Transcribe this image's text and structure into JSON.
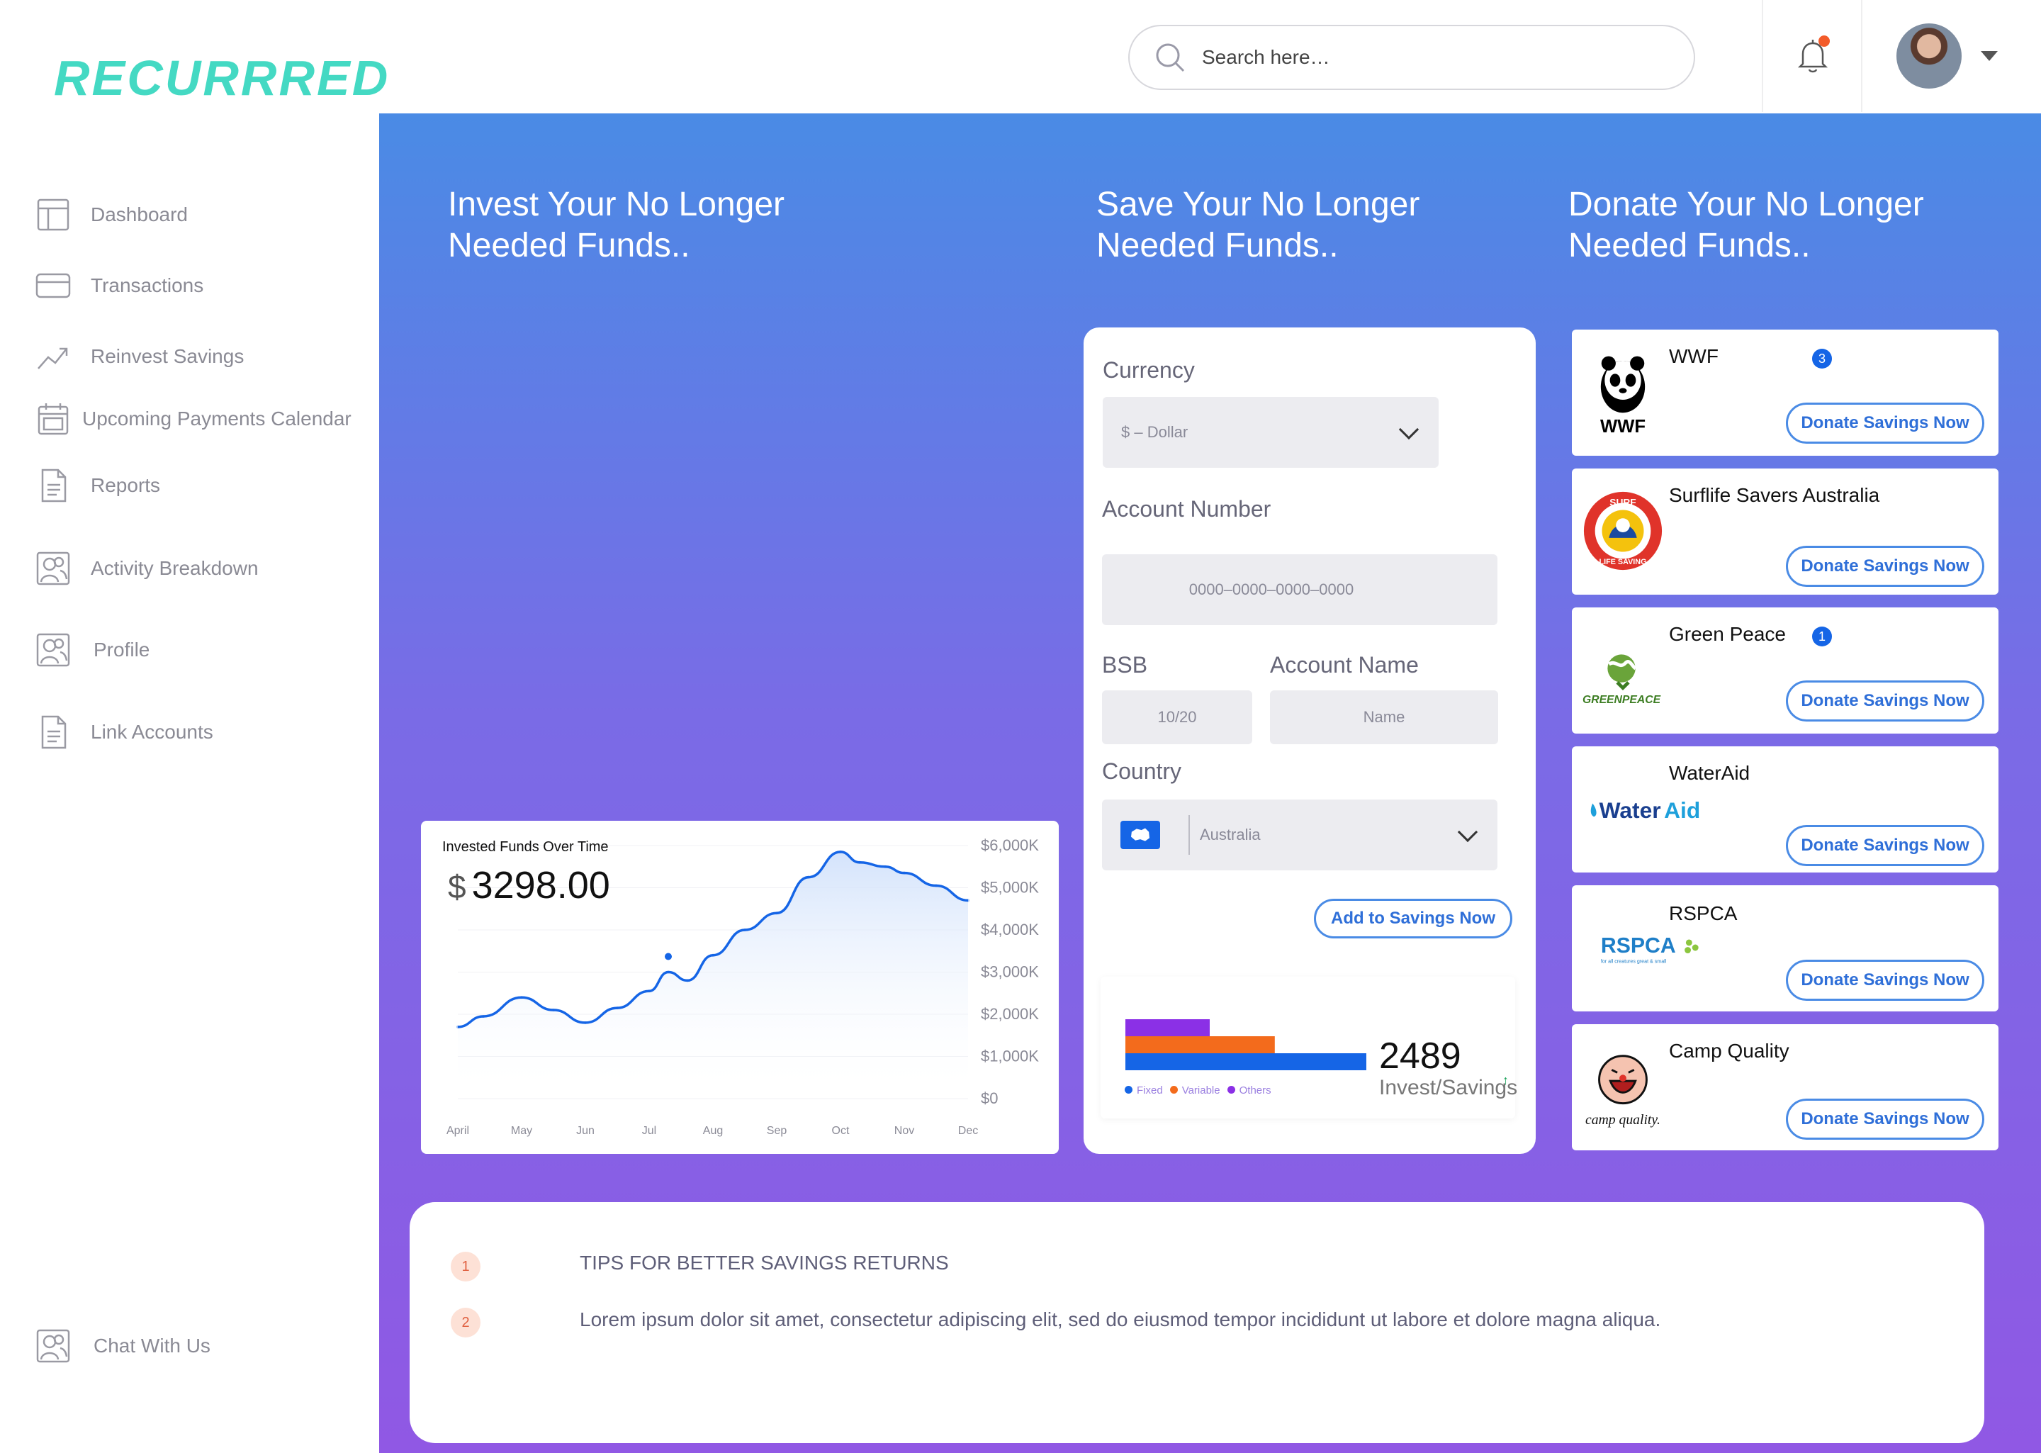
{
  "app": {
    "logo": "RECURRRED"
  },
  "sidebar": {
    "items": [
      {
        "label": "Dashboard",
        "icon": "dashboard-icon"
      },
      {
        "label": "Transactions",
        "icon": "card-icon"
      },
      {
        "label": "Reinvest Savings",
        "icon": "trend-icon"
      },
      {
        "label": "Upcoming Payments Calendar",
        "icon": "calendar-icon"
      },
      {
        "label": "Reports",
        "icon": "document-icon"
      },
      {
        "label": "Activity Breakdown",
        "icon": "users-icon"
      },
      {
        "label": "Profile",
        "icon": "user-icon"
      },
      {
        "label": "Link Accounts",
        "icon": "document-icon"
      }
    ],
    "chat": {
      "label": "Chat With Us",
      "icon": "user-icon"
    }
  },
  "header": {
    "search_placeholder": "Search here…",
    "notification_icon": "bell-icon"
  },
  "invest": {
    "title_line1": "Invest Your No Longer",
    "title_line2": "Needed Funds..",
    "chart_title": "Invested Funds Over Time",
    "currency_symbol": "$",
    "amount": "3298.00"
  },
  "save": {
    "title_line1": "Save Your No Longer",
    "title_line2": "Needed Funds..",
    "currency_label": "Currency",
    "currency_value": "$ – Dollar",
    "account_number_label": "Account Number",
    "account_number_placeholder": "0000–0000–0000–0000",
    "bsb_label": "BSB",
    "bsb_placeholder": "10/20",
    "account_name_label": "Account Name",
    "account_name_placeholder": "Name",
    "country_label": "Country",
    "country_value": "Australia",
    "add_button": "Add to Savings Now",
    "stat_value": "2489",
    "stat_label": "Invest/Savings",
    "legend": [
      "Fixed",
      "Variable",
      "Others"
    ]
  },
  "donate": {
    "title_line1": "Donate Your No Longer",
    "title_line2": "Needed Funds..",
    "button_label": "Donate Savings Now",
    "charities": [
      {
        "name": "WWF",
        "badge": "3",
        "logo_text": "WWF"
      },
      {
        "name": "Surflife Savers Australia",
        "badge": "",
        "logo_text": "SURF LIFE SAVING"
      },
      {
        "name": "Green Peace",
        "badge": "1",
        "logo_text": "GREENPEACE"
      },
      {
        "name": "WaterAid",
        "badge": "",
        "logo_text": "WaterAid"
      },
      {
        "name": "RSPCA",
        "badge": "",
        "logo_text": "RSPCA"
      },
      {
        "name": "Camp Quality",
        "badge": "",
        "logo_text": "camp quality."
      }
    ]
  },
  "tips": {
    "items": [
      {
        "num": "1",
        "text": "TIPS FOR BETTER SAVINGS RETURNS"
      },
      {
        "num": "2",
        "text": "Lorem ipsum dolor sit amet, consectetur adipiscing elit, sed do eiusmod tempor incididunt ut labore et dolore magna aliqua."
      }
    ]
  },
  "chart_data": [
    {
      "type": "line",
      "title": "Invested Funds Over Time",
      "categories": [
        "April",
        "May",
        "Jun",
        "Jul",
        "Aug",
        "Sep",
        "Oct",
        "Nov",
        "Dec"
      ],
      "y_ticks": [
        "$0",
        "$1,000K",
        "$2,000K",
        "$3,000K",
        "$4,000K",
        "$5,000K",
        "$6,000K"
      ],
      "ylim": [
        0,
        6000
      ],
      "series": [
        {
          "x": [
            0,
            0.4,
            1,
            1.5,
            2,
            2.5,
            3,
            3.3,
            3.6,
            4,
            4.5,
            5,
            5.5,
            6,
            6.3,
            6.7,
            7,
            7.5,
            8
          ],
          "values": [
            1700,
            1950,
            2400,
            2100,
            1800,
            2150,
            2550,
            3000,
            2800,
            3400,
            4000,
            4400,
            5250,
            5850,
            5600,
            5500,
            5350,
            5050,
            4700
          ]
        }
      ]
    },
    {
      "type": "bar",
      "categories": [
        "Others",
        "Variable",
        "Fixed"
      ],
      "values": [
        35,
        62,
        100
      ],
      "colors": [
        "#8b30e6",
        "#f36b1c",
        "#1565e6"
      ]
    }
  ]
}
